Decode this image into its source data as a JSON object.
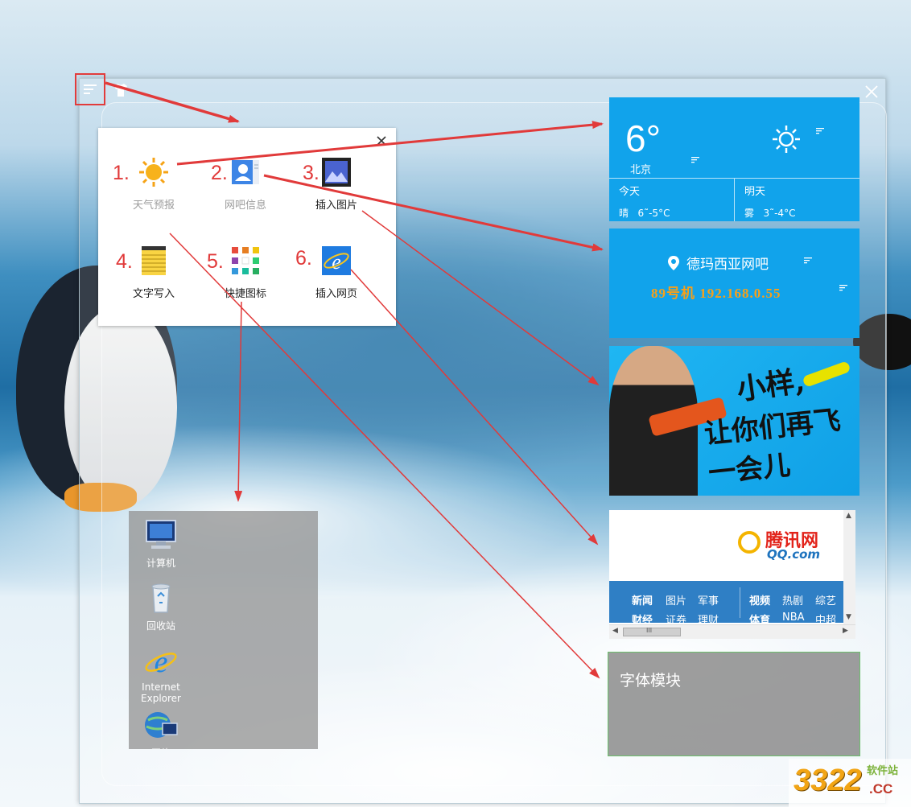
{
  "colors": {
    "tile_blue": "#11a3eb",
    "annotation_red": "#e13a3a",
    "ip_orange": "#f6a01a"
  },
  "popup": {
    "items": [
      {
        "num": "1.",
        "label": "天气预报",
        "icon": "sun-icon"
      },
      {
        "num": "2.",
        "label": "网吧信息",
        "icon": "profile-card-icon"
      },
      {
        "num": "3.",
        "label": "插入图片",
        "icon": "image-icon"
      },
      {
        "num": "4.",
        "label": "文字写入",
        "icon": "notepad-icon"
      },
      {
        "num": "5.",
        "label": "快捷图标",
        "icon": "grid-icon"
      },
      {
        "num": "6.",
        "label": "插入网页",
        "icon": "ie-icon"
      }
    ]
  },
  "weather": {
    "temp": "6°",
    "city": "北京",
    "today_label": "今天",
    "tomorrow_label": "明天",
    "today_weather": "晴",
    "today_range": "6˜-5°C",
    "tomorrow_weather": "雾",
    "tomorrow_range": "3˜-4°C"
  },
  "netbar": {
    "name": "德玛西亚网吧",
    "machine_ip": "89号机  192.168.0.55"
  },
  "banner": {
    "line1": "小样,",
    "line2": "让你们再飞一会儿"
  },
  "qq": {
    "brand": "腾讯网",
    "domain": "QQ.com",
    "nav_row1": [
      "新闻",
      "图片",
      "军事",
      "视频",
      "热剧",
      "综艺"
    ],
    "nav_row2": [
      "财经",
      "证券",
      "理财",
      "体育",
      "NBA",
      "中超"
    ],
    "scroll_grip": "III"
  },
  "font_module": {
    "title": "字体模块"
  },
  "desktop": {
    "icons": [
      {
        "label": "计算机",
        "icon": "computer-icon"
      },
      {
        "label": "回收站",
        "icon": "recycle-bin-icon"
      },
      {
        "label": "Internet Explorer",
        "icon": "ie-icon"
      },
      {
        "label": "网络",
        "icon": "network-icon"
      }
    ]
  },
  "watermark": {
    "number": "3322",
    "site": "软件站",
    "tld": ".CC"
  }
}
